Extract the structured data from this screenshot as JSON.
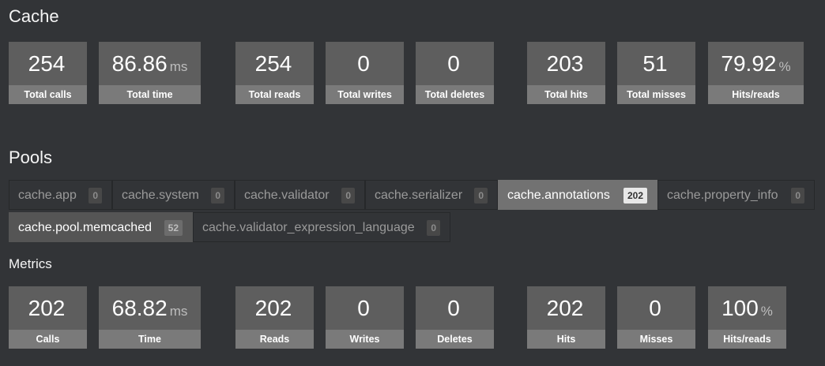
{
  "cache": {
    "title": "Cache",
    "metrics": [
      {
        "value": "254",
        "unit": "",
        "label": "Total calls"
      },
      {
        "value": "86.86",
        "unit": "ms",
        "label": "Total time"
      },
      {
        "value": "254",
        "unit": "",
        "label": "Total reads"
      },
      {
        "value": "0",
        "unit": "",
        "label": "Total writes"
      },
      {
        "value": "0",
        "unit": "",
        "label": "Total deletes"
      },
      {
        "value": "203",
        "unit": "",
        "label": "Total hits"
      },
      {
        "value": "51",
        "unit": "",
        "label": "Total misses"
      },
      {
        "value": "79.92",
        "unit": "%",
        "label": "Hits/reads"
      }
    ]
  },
  "pools": {
    "title": "Pools",
    "tabs": [
      {
        "label": "cache.app",
        "count": "0"
      },
      {
        "label": "cache.system",
        "count": "0"
      },
      {
        "label": "cache.validator",
        "count": "0"
      },
      {
        "label": "cache.serializer",
        "count": "0"
      },
      {
        "label": "cache.annotations",
        "count": "202"
      },
      {
        "label": "cache.property_info",
        "count": "0"
      },
      {
        "label": "cache.pool.memcached",
        "count": "52"
      },
      {
        "label": "cache.validator_expression_language",
        "count": "0"
      }
    ]
  },
  "metrics_section": {
    "title": "Metrics",
    "metrics": [
      {
        "value": "202",
        "unit": "",
        "label": "Calls"
      },
      {
        "value": "68.82",
        "unit": "ms",
        "label": "Time"
      },
      {
        "value": "202",
        "unit": "",
        "label": "Reads"
      },
      {
        "value": "0",
        "unit": "",
        "label": "Writes"
      },
      {
        "value": "0",
        "unit": "",
        "label": "Deletes"
      },
      {
        "value": "202",
        "unit": "",
        "label": "Hits"
      },
      {
        "value": "0",
        "unit": "",
        "label": "Misses"
      },
      {
        "value": "100",
        "unit": "%",
        "label": "Hits/reads"
      }
    ]
  }
}
